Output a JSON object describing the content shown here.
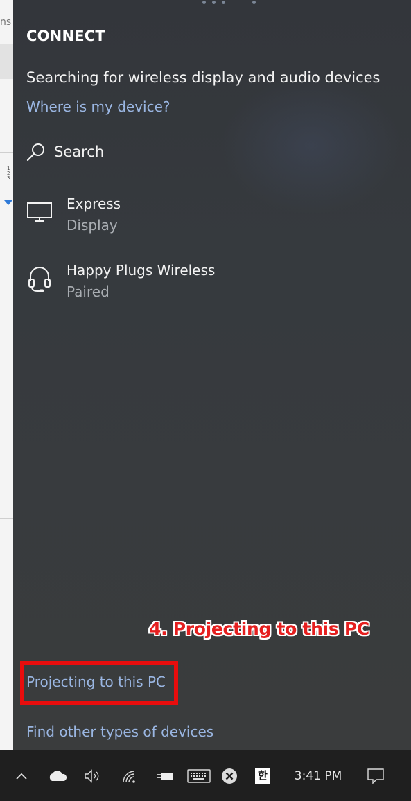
{
  "background_window": {
    "fragment_text": "ns"
  },
  "flyout": {
    "title": "CONNECT",
    "status": "Searching for wireless display and audio devices",
    "where_link": "Where is my device?",
    "search_label": "Search",
    "devices": [
      {
        "name": "Express",
        "sub": "Display",
        "icon": "monitor-icon"
      },
      {
        "name": "Happy Plugs Wireless",
        "sub": "Paired",
        "icon": "headset-icon"
      }
    ],
    "projecting_link": "Projecting to this PC",
    "find_other_link": "Find other types of devices"
  },
  "annotation": {
    "text": "4. Projecting to this PC",
    "color": "#e51f1f"
  },
  "taskbar": {
    "ime_label": "한",
    "clock": "3:41 PM",
    "icons": [
      "chevron-up-icon",
      "onedrive-cloud-icon",
      "volume-icon",
      "wifi-icon",
      "power-plug-icon",
      "touch-keyboard-icon",
      "close-circle-icon",
      "ime-hangul-icon",
      "action-center-icon"
    ]
  },
  "colors": {
    "panel_bg": "#363a3e",
    "link": "#9ab6e2",
    "highlight": "#e80d0d",
    "taskbar_bg": "#1f1f1f"
  }
}
